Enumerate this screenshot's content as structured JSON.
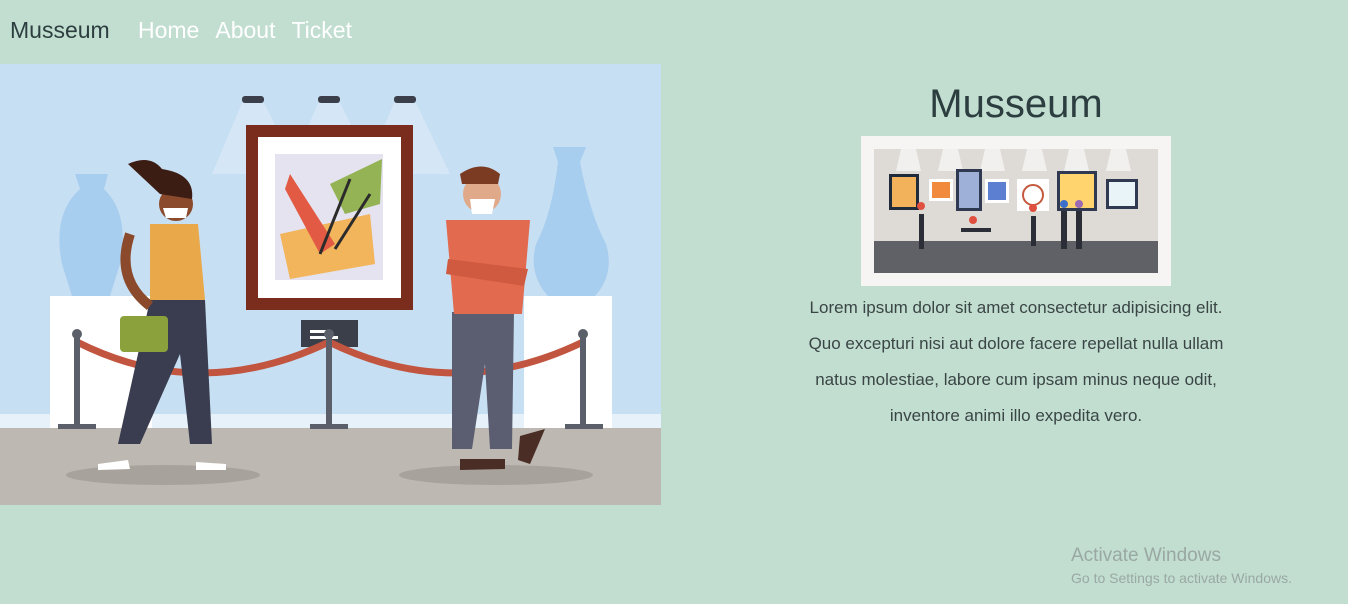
{
  "nav": {
    "brand": "Musseum",
    "links": [
      "Home",
      "About",
      "Ticket"
    ]
  },
  "main": {
    "title": "Musseum",
    "description": "Lorem ipsum dolor sit amet consectetur adipisicing elit. Quo excepturi nisi aut dolore facere repellat nulla ullam natus molestiae, labore cum ipsam minus neque odit, inventore animi illo expedita vero."
  },
  "watermark": {
    "title": "Activate Windows",
    "subtitle": "Go to Settings to activate Windows."
  },
  "colors": {
    "background": "#c2ded1",
    "nav_link": "#ffffff",
    "text": "#2c3e3f"
  }
}
